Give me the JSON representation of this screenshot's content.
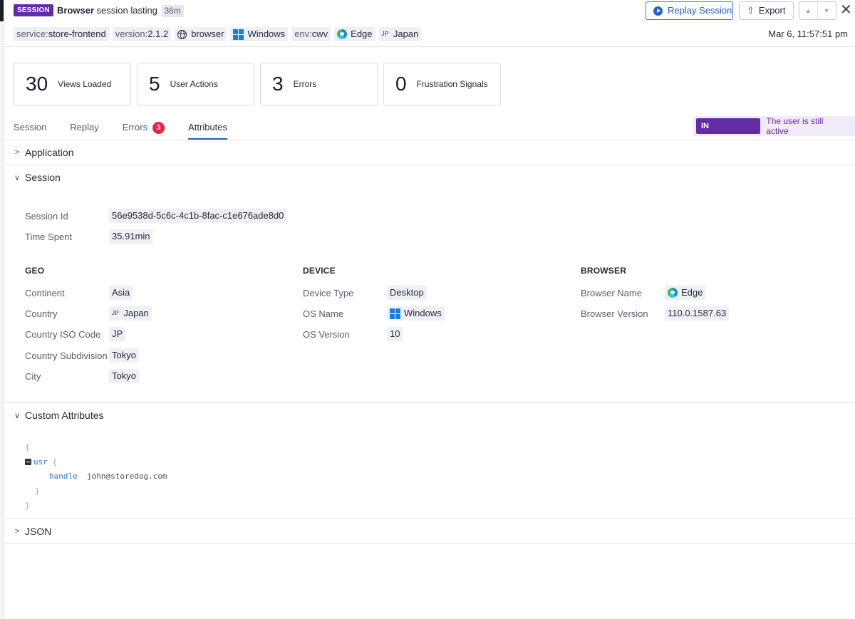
{
  "header": {
    "session_pill": "SESSION",
    "title_bold": "Browser",
    "title_rest": " session lasting",
    "duration": "36m",
    "replay_button": "Replay Session",
    "export_button": "Export",
    "nav_up": "▲",
    "nav_down": "▼",
    "close": "✕",
    "date": "Mar 6, 11:57:51 pm"
  },
  "tags": {
    "service_key": "service:",
    "service_val": "store-frontend",
    "version_key": "version:",
    "version_val": "2.1.2",
    "type": "browser",
    "os": "Windows",
    "env_key": "env:",
    "env_val": "cwv",
    "browser": "Edge",
    "country_flag": "JP",
    "country": "Japan"
  },
  "stats": [
    {
      "num": "30",
      "label": "Views Loaded"
    },
    {
      "num": "5",
      "label": "User Actions"
    },
    {
      "num": "3",
      "label": "Errors"
    },
    {
      "num": "0",
      "label": "Frustration Signals"
    }
  ],
  "tabs": {
    "session": "Session",
    "replay": "Replay",
    "errors": "Errors",
    "errors_count": "3",
    "attributes": "Attributes"
  },
  "status": {
    "pill": "IN PROGRESS",
    "text": "The user is still active"
  },
  "sections": {
    "application": "Application",
    "session": "Session",
    "custom": "Custom Attributes",
    "json": "JSON"
  },
  "session": {
    "id_label": "Session Id",
    "id_value": "56e9538d-5c6c-4c1b-8fac-c1e676ade8d0",
    "time_label": "Time Spent",
    "time_value": "35.91min"
  },
  "geo": {
    "title": "GEO",
    "continent_label": "Continent",
    "continent": "Asia",
    "country_label": "Country",
    "country_flag": "JP",
    "country": "Japan",
    "iso_label": "Country ISO Code",
    "iso": "JP",
    "subdivision_label": "Country Subdivision",
    "subdivision": "Tokyo",
    "city_label": "City",
    "city": "Tokyo"
  },
  "device": {
    "title": "DEVICE",
    "type_label": "Device Type",
    "type": "Desktop",
    "os_label": "OS Name",
    "os": "Windows",
    "version_label": "OS Version",
    "version": "10"
  },
  "browser": {
    "title": "BROWSER",
    "name_label": "Browser Name",
    "name": "Edge",
    "version_label": "Browser Version",
    "version": "110.0.1587.63"
  },
  "custom_attributes": {
    "open_brace": "{",
    "usr_key": "usr",
    "usr_open": " {",
    "handle_key": "handle",
    "handle_value": "john@storedog.com",
    "usr_close": "}",
    "close_brace": "}"
  },
  "colors": {
    "accent": "#632ca6",
    "link": "#2361c7",
    "error": "#e0294a"
  }
}
